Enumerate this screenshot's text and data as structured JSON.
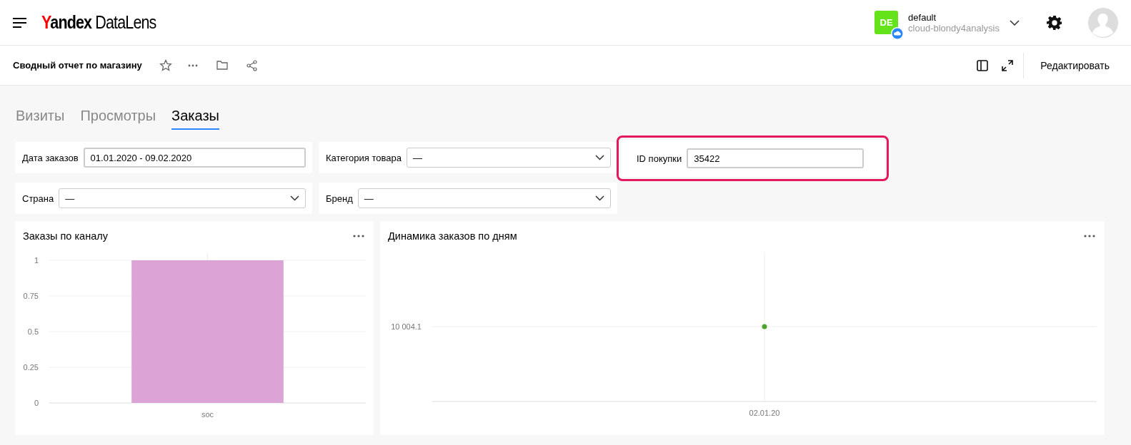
{
  "header": {
    "logo": {
      "brand": "Yandex",
      "product": "DataLens"
    },
    "account": {
      "initials": "DE",
      "name": "default",
      "cloud": "cloud-blondy4analysis"
    }
  },
  "toolbar": {
    "title": "Сводный отчет по магазину",
    "edit_button": "Редактировать"
  },
  "tabs": [
    {
      "label": "Визиты",
      "selected": false
    },
    {
      "label": "Просмотры",
      "selected": false
    },
    {
      "label": "Заказы",
      "selected": true
    }
  ],
  "filters": [
    {
      "kind": "date",
      "label": "Дата заказов",
      "value": "01.01.2020 - 09.02.2020",
      "highlighted": false
    },
    {
      "kind": "select",
      "label": "Категория товара",
      "value": "—",
      "highlighted": false
    },
    {
      "kind": "text",
      "label": "ID покупки",
      "value": "35422",
      "highlighted": true
    },
    {
      "kind": "select",
      "label": "Страна",
      "value": "—",
      "highlighted": false
    },
    {
      "kind": "select",
      "label": "Бренд",
      "value": "—",
      "highlighted": false
    }
  ],
  "widgets": [
    {
      "title": "Заказы по каналу",
      "chart_data": {
        "type": "bar",
        "categories": [
          "soc"
        ],
        "values": [
          1
        ],
        "ylim": [
          0,
          1
        ],
        "yticks": [
          0,
          0.25,
          0.5,
          0.75,
          1
        ],
        "grid": true
      }
    },
    {
      "title": "Динамика заказов по дням",
      "y_axis_labels": [
        "10 004.1"
      ],
      "x_axis_labels": [
        "02.01.20"
      ]
    }
  ]
}
